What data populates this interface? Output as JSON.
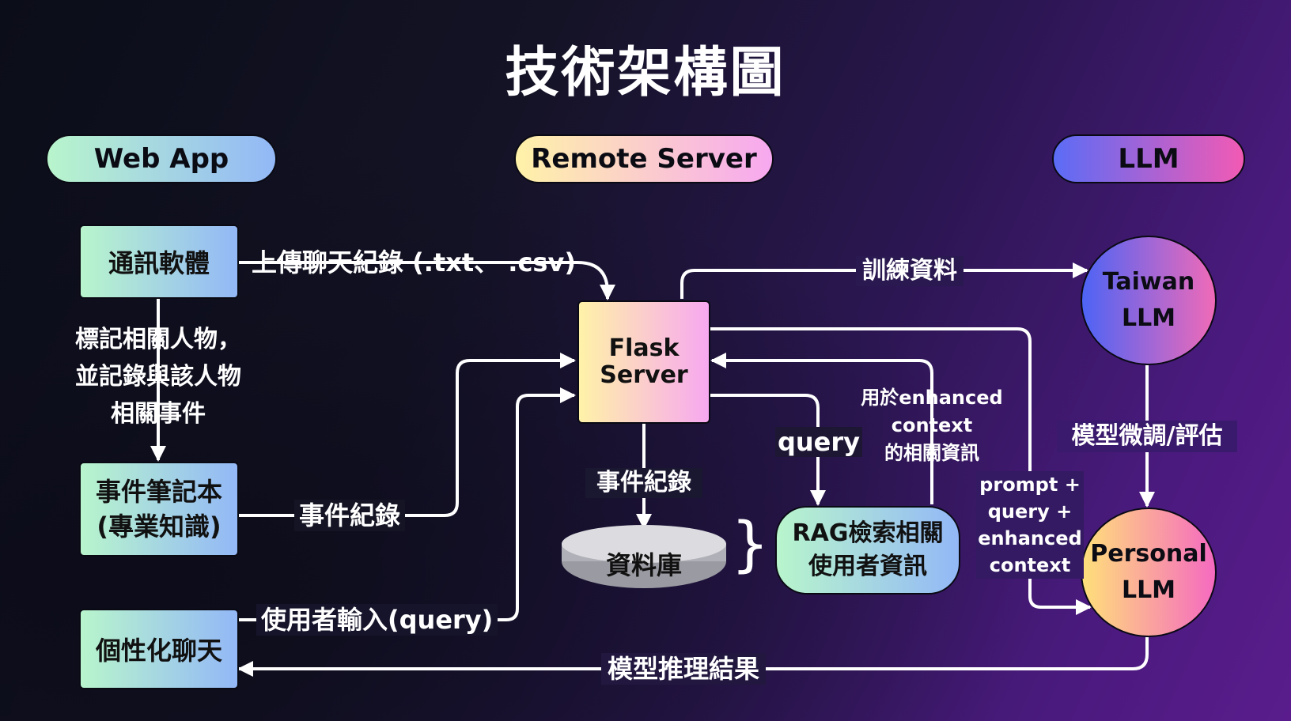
{
  "title": "技術架構圖",
  "columns": {
    "web_app": "Web App",
    "remote_server": "Remote Server",
    "llm": "LLM"
  },
  "nodes": {
    "messaging_app": "通訊軟體",
    "event_notebook_line1": "事件筆記本",
    "event_notebook_line2": "(專業知識)",
    "personal_chat": "個性化聊天",
    "flask_line1": "Flask",
    "flask_line2": "Server",
    "database": "資料庫",
    "rag_line1": "RAG檢索相關",
    "rag_line2": "使用者資訊",
    "taiwan_llm_line1": "Taiwan",
    "taiwan_llm_line2": "LLM",
    "personal_llm_line1": "Personal",
    "personal_llm_line2": "LLM"
  },
  "edges": {
    "upload_chat": "上傳聊天紀錄 (.txt、 .csv)",
    "tag_people_line1": "標記相關人物，",
    "tag_people_line2": "並記錄與該人物",
    "tag_people_line3": "相關事件",
    "event_record_left": "事件紀錄",
    "user_input": "使用者輸入(query)",
    "event_record_db": "事件紀錄",
    "query": "query",
    "enhanced_line1": "用於enhanced",
    "enhanced_line2": "context",
    "enhanced_line3": "的相關資訊",
    "training_data": "訓練資料",
    "finetune_eval": "模型微調/評估",
    "prompt_line1": "prompt +",
    "prompt_line2": "query +",
    "prompt_line3": "enhanced",
    "prompt_line4": "context",
    "inference_result": "模型推理結果",
    "brace": "}"
  },
  "colors": {
    "web_app_gradient": [
      "#b8f5cc",
      "#93b8f7"
    ],
    "remote_server_gradient": [
      "#fff2a8",
      "#f7a8f0"
    ],
    "llm_pill_gradient": [
      "#5b6cf6",
      "#f25ab4"
    ],
    "taiwan_llm_gradient": [
      "#4d64f5",
      "#f06ab8"
    ],
    "personal_llm_gradient": [
      "#ffe07a",
      "#f56ac0"
    ],
    "line": "#ffffff"
  }
}
